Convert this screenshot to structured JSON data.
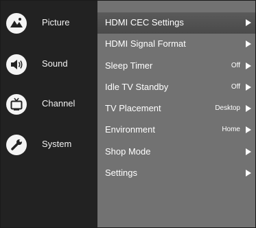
{
  "sidebar": {
    "items": [
      {
        "label": "Picture",
        "icon": "picture-icon"
      },
      {
        "label": "Sound",
        "icon": "speaker-icon"
      },
      {
        "label": "Channel",
        "icon": "tv-icon"
      },
      {
        "label": "System",
        "icon": "wrench-icon"
      }
    ]
  },
  "menu": {
    "items": [
      {
        "label": "HDMI CEC Settings",
        "value": ""
      },
      {
        "label": "HDMI Signal Format",
        "value": ""
      },
      {
        "label": "Sleep Timer",
        "value": "Off"
      },
      {
        "label": "Idle TV Standby",
        "value": "Off"
      },
      {
        "label": "TV Placement",
        "value": "Desktop"
      },
      {
        "label": "Environment",
        "value": "Home"
      },
      {
        "label": "Shop Mode",
        "value": ""
      },
      {
        "label": "Settings",
        "value": ""
      }
    ],
    "arrow_icon": "chevron-right-icon"
  },
  "colors": {
    "sidebar_bg": "#222222",
    "menu_bg": "#727272",
    "selected_bg": "#505050",
    "icon_bg": "#f4f4f4"
  }
}
